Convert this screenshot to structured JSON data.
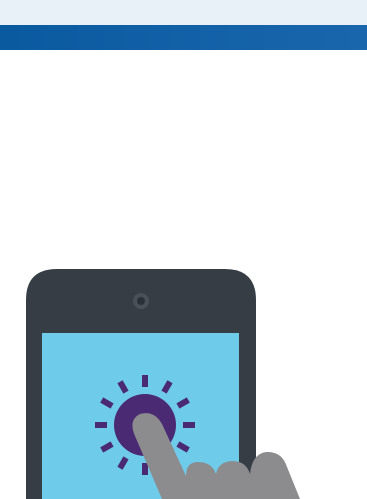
{
  "colors": {
    "top_band": "#e8f1f8",
    "header_bar_start": "#0a5aa0",
    "header_bar_end": "#1a66ad",
    "phone_body": "#363d45",
    "phone_camera": "#4a5058",
    "phone_camera_inner": "#2b3036",
    "screen": "#6ecbe9",
    "sun_rays": "#4b2a74",
    "sun_disc": "#4b2a74",
    "hand": "#8c8c8f"
  },
  "illustration": {
    "subject": "phone-tap-icon",
    "description_icons": [
      "smartphone-icon",
      "sun-burst-icon",
      "pointing-hand-icon"
    ]
  }
}
